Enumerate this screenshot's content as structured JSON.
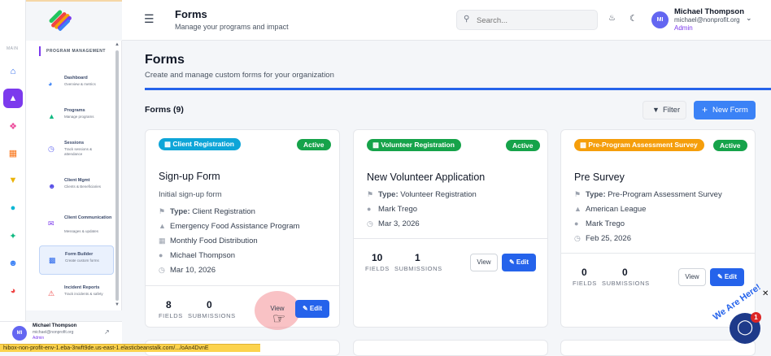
{
  "sidebar": {
    "rail_label": "MAIN",
    "section_title": "PROGRAM MANAGEMENT",
    "items": [
      {
        "label": "Dashboard",
        "sub": "Overview & metrics"
      },
      {
        "label": "Programs",
        "sub": "Manage programs"
      },
      {
        "label": "Sessions",
        "sub": "Track sessions & attendance"
      },
      {
        "label": "Client Mgmt",
        "sub": "Clients & Beneficiaries"
      },
      {
        "label": "Client Communication",
        "sub": "Messages & updates"
      },
      {
        "label": "Form Builder",
        "sub": "Create custom forms"
      },
      {
        "label": "Incident Reports",
        "sub": "Track incidents & safety"
      }
    ],
    "user": {
      "initials": "MI",
      "name": "Michael Thompson",
      "email": "michael@nonprofit.org",
      "role": "Admin"
    }
  },
  "header": {
    "title": "Forms",
    "subtitle": "Manage your programs and impact",
    "search_placeholder": "Search...",
    "user": {
      "initials": "MI",
      "name": "Michael Thompson",
      "email": "michael@nonprofit.org",
      "role": "Admin"
    }
  },
  "page": {
    "title": "Forms",
    "subtitle": "Create and manage custom forms for your organization",
    "count_label": "Forms (9)",
    "filter_label": "Filter",
    "new_form_label": "New Form"
  },
  "cards": [
    {
      "category": "Client Registration",
      "category_color": "#0ea5d8",
      "status": "Active",
      "title": "Sign-up Form",
      "description": "Initial sign-up form",
      "type_label": "Type:",
      "type": "Client Registration",
      "program": "Emergency Food Assistance Program",
      "session": "Monthly Food Distribution",
      "owner": "Michael Thompson",
      "date": "Mar 10, 2026",
      "fields": "8",
      "fields_label": "FIELDS",
      "submissions": "0",
      "submissions_label": "SUBMISSIONS",
      "view_label": "View",
      "edit_label": "Edit"
    },
    {
      "category": "Volunteer Registration",
      "category_color": "#16a34a",
      "status": "Active",
      "title": "New Volunteer Application",
      "type_label": "Type:",
      "type": "Volunteer Registration",
      "owner": "Mark Trego",
      "date": "Mar 3, 2026",
      "fields": "10",
      "fields_label": "FIELDS",
      "submissions": "1",
      "submissions_label": "SUBMISSIONS",
      "view_label": "View",
      "edit_label": "Edit"
    },
    {
      "category": "Pre-Program Assessment Survey",
      "category_color": "#f59e0b",
      "status": "Active",
      "title": "Pre Survey",
      "type_label": "Type:",
      "type": "Pre-Program Assessment Survey",
      "program": "American League",
      "owner": "Mark Trego",
      "date": "Feb 25, 2026",
      "fields": "0",
      "fields_label": "FIELDS",
      "submissions": "0",
      "submissions_label": "SUBMISSIONS",
      "view_label": "View",
      "edit_label": "Edit"
    }
  ],
  "chat_widget": {
    "badge": "1",
    "tagline": "We Are Here!"
  },
  "status_bar_url": "hibox-non-profit-env-1.eba-3rwft9de.us-east-1.elasticbeanstalk.com/.../oAn4DvnE",
  "colors": {
    "accent": "#2563eb",
    "brand_purple": "#7c3aed",
    "active_green": "#16a34a"
  }
}
